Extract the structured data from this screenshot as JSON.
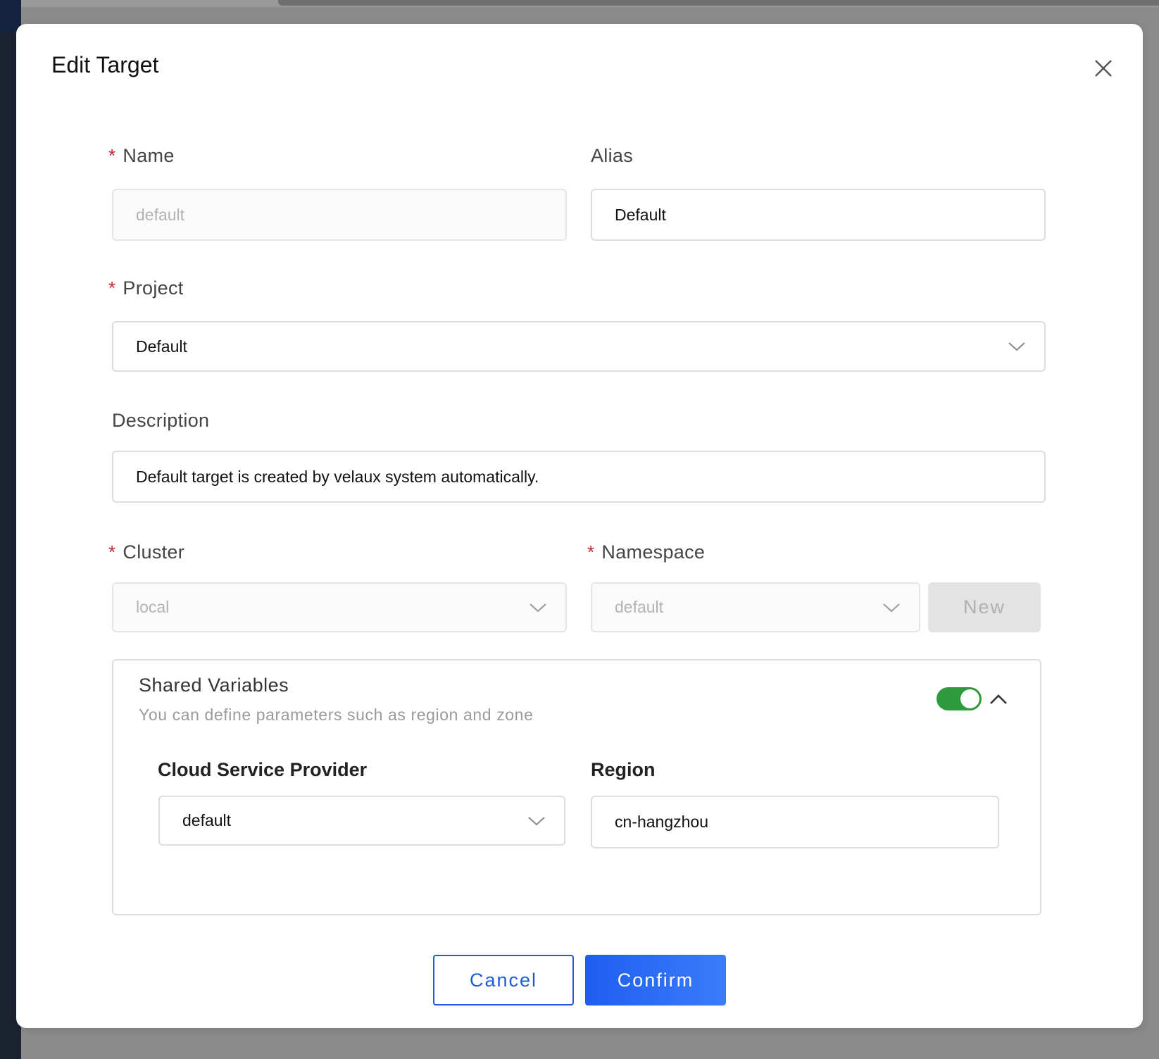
{
  "modal": {
    "title": "Edit Target"
  },
  "form": {
    "name": {
      "label": "Name",
      "required_mark": "*",
      "value": "default"
    },
    "alias": {
      "label": "Alias",
      "value": "Default"
    },
    "project": {
      "label": "Project",
      "required_mark": "*",
      "value": "Default"
    },
    "description": {
      "label": "Description",
      "value": "Default target is created by velaux system automatically."
    },
    "cluster": {
      "label": "Cluster",
      "required_mark": "*",
      "value": "local"
    },
    "namespace": {
      "label": "Namespace",
      "required_mark": "*",
      "value": "default",
      "new_label": "New"
    }
  },
  "shared_variables": {
    "title": "Shared Variables",
    "subtitle": "You can define parameters such as region and zone",
    "enabled": true,
    "expanded": true,
    "cloud_service_provider": {
      "label": "Cloud Service Provider",
      "value": "default"
    },
    "region": {
      "label": "Region",
      "value": "cn-hangzhou"
    }
  },
  "actions": {
    "cancel_label": "Cancel",
    "confirm_label": "Confirm"
  },
  "colors": {
    "primary": "#1f5bd8",
    "toggle_on": "#2e9a3c",
    "required": "#c8242b"
  }
}
